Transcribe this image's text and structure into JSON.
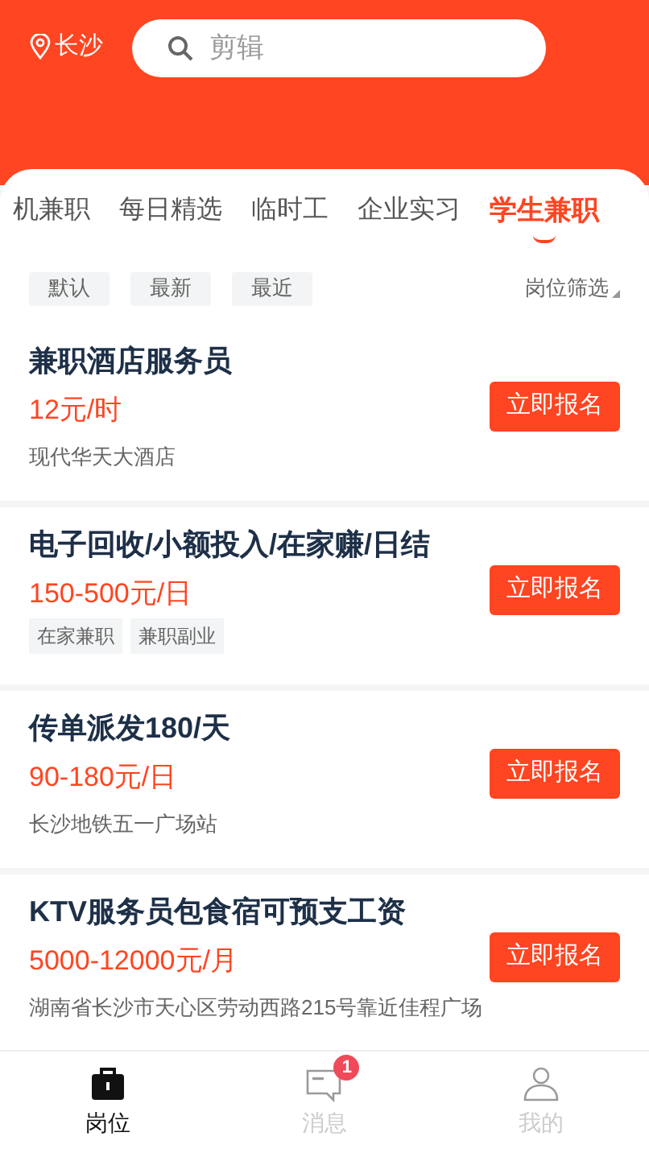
{
  "header": {
    "city": "长沙",
    "search": {
      "placeholder": "剪辑"
    }
  },
  "tabs": [
    {
      "label": "机兼职",
      "selected": false
    },
    {
      "label": "每日精选",
      "selected": false
    },
    {
      "label": "临时工",
      "selected": false
    },
    {
      "label": "企业实习",
      "selected": false
    },
    {
      "label": "学生兼职",
      "selected": true
    }
  ],
  "sort_options": [
    "默认",
    "最新",
    "最近"
  ],
  "filter": "岗位筛选",
  "jobs": [
    {
      "title": "兼职酒店服务员",
      "salary": "12元/时",
      "kind": "location",
      "location": "现代华天大酒店",
      "button": "立即报名"
    },
    {
      "title": "电子回收/小额投入/在家赚/日结",
      "salary": "150-500元/日",
      "kind": "tags",
      "tags": [
        "在家兼职",
        "兼职副业"
      ],
      "button": "立即报名"
    },
    {
      "title": "传单派发180/天",
      "salary": "90-180元/日",
      "kind": "location",
      "location": "长沙地铁五一广场站",
      "button": "立即报名"
    },
    {
      "title": "KTV服务员包食宿可预支工资",
      "salary": "5000-12000元/月",
      "kind": "location",
      "location": "湖南省长沙市天心区劳动西路215号靠近佳程广场",
      "button": "立即报名"
    }
  ],
  "nav": [
    {
      "label": "岗位",
      "kind": "briefcase",
      "selected": true
    },
    {
      "label": "消息",
      "kind": "message",
      "selected": false,
      "badge": "1"
    },
    {
      "label": "我的",
      "kind": "user",
      "selected": false
    }
  ]
}
